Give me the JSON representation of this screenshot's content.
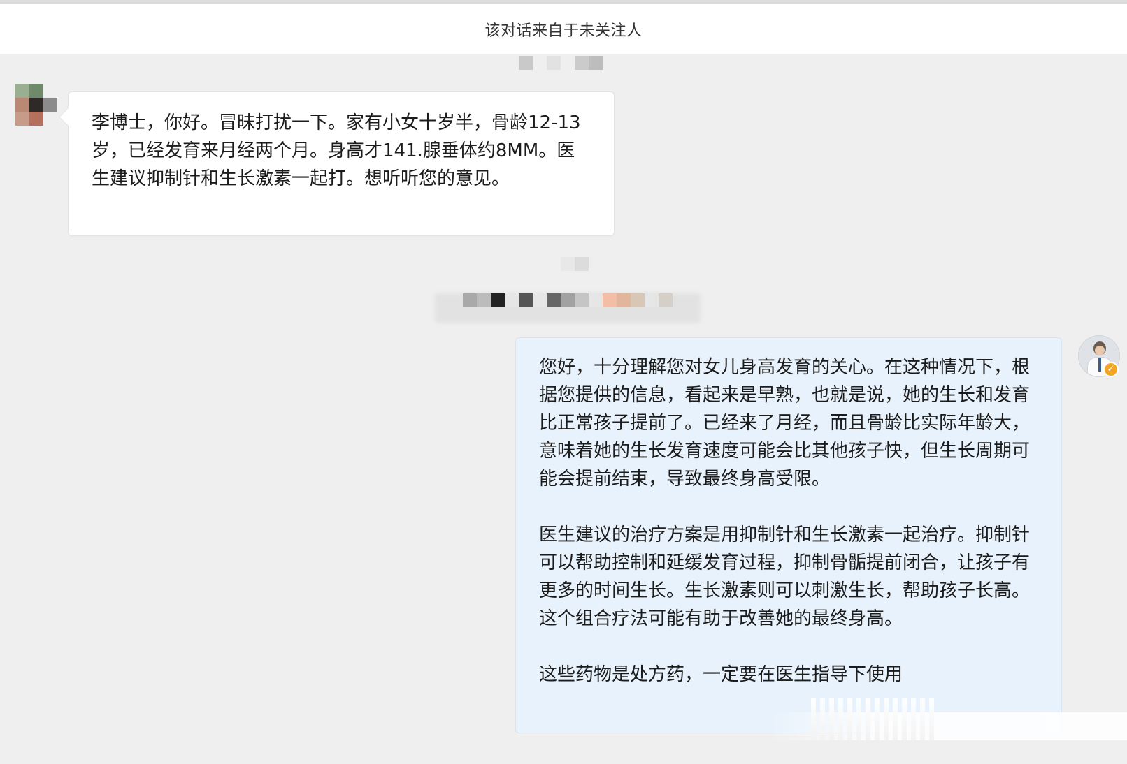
{
  "header": {
    "title": "该对话来自于未关注人"
  },
  "messages": {
    "incoming": {
      "text": "李博士，你好。冒昧打扰一下。家有小女十岁半，骨龄12-13岁，已经发育来月经两个月。身高才141.腺垂体约8MM。医生建议抑制针和生长激素一起打。想听听您的意见。"
    },
    "reply": {
      "paragraphs": [
        "您好，十分理解您对女儿身高发育的关心。在这种情况下，根据您提供的信息，看起来是早熟，也就是说，她的生长和发育比正常孩子提前了。已经来了月经，而且骨龄比实际年龄大，意味着她的生长发育速度可能会比其他孩子快，但生长周期可能会提前结束，导致最终身高受限。",
        "医生建议的治疗方案是用抑制针和生长激素一起治疗。抑制针可以帮助控制和延缓发育过程，抑制骨骺提前闭合，让孩子有更多的时间生长。生长激素则可以刺激生长，帮助孩子长高。这个组合疗法可能有助于改善她的最终身高。",
        "这些药物是处方药，一定要在医生指导下使用"
      ]
    }
  },
  "icons": {
    "verified": "verified-badge-icon",
    "avatar_left": "avatar-pixelated",
    "avatar_right": "doctor-avatar"
  },
  "colors": {
    "background": "#efefef",
    "incoming_bubble": "#ffffff",
    "reply_bubble": "#e8f2fc",
    "verified": "#f3a623"
  }
}
